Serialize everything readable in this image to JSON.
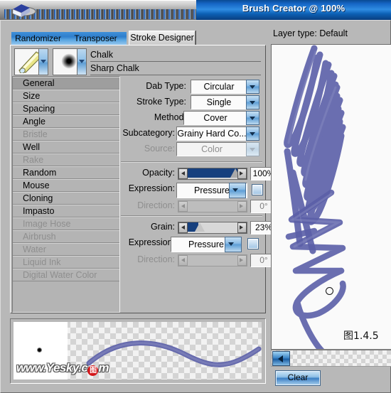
{
  "window": {
    "title": "Brush Creator @ 100%",
    "grip_icon": "paint-bucket-icon"
  },
  "tabs": [
    {
      "label": "Randomizer",
      "active": false
    },
    {
      "label": "Transposer",
      "active": false
    },
    {
      "label": "Stroke Designer",
      "active": true
    }
  ],
  "brush_header": {
    "category_thumb_icon": "chalk-stick-icon",
    "variant_thumb_icon": "soft-dab-icon",
    "category_name": "Chalk",
    "variant_name": "Sharp Chalk"
  },
  "categories": [
    {
      "label": "General",
      "selected": true,
      "enabled": true
    },
    {
      "label": "Size",
      "selected": false,
      "enabled": true
    },
    {
      "label": "Spacing",
      "selected": false,
      "enabled": true
    },
    {
      "label": "Angle",
      "selected": false,
      "enabled": true
    },
    {
      "label": "Bristle",
      "selected": false,
      "enabled": false
    },
    {
      "label": "Well",
      "selected": false,
      "enabled": true
    },
    {
      "label": "Rake",
      "selected": false,
      "enabled": false
    },
    {
      "label": "Random",
      "selected": false,
      "enabled": true
    },
    {
      "label": "Mouse",
      "selected": false,
      "enabled": true
    },
    {
      "label": "Cloning",
      "selected": false,
      "enabled": true
    },
    {
      "label": "Impasto",
      "selected": false,
      "enabled": true
    },
    {
      "label": "Image Hose",
      "selected": false,
      "enabled": false
    },
    {
      "label": "Airbrush",
      "selected": false,
      "enabled": false
    },
    {
      "label": "Water",
      "selected": false,
      "enabled": false
    },
    {
      "label": "Liquid Ink",
      "selected": false,
      "enabled": false
    },
    {
      "label": "Digital Water Color",
      "selected": false,
      "enabled": false
    }
  ],
  "general": {
    "dab_type": {
      "label": "Dab Type:",
      "value": "Circular"
    },
    "stroke_type": {
      "label": "Stroke Type:",
      "value": "Single"
    },
    "method": {
      "label": "Method:",
      "value": "Cover"
    },
    "subcategory": {
      "label": "Subcategory:",
      "value": "Grainy Hard Co..."
    },
    "source": {
      "label": "Source:",
      "value": "Color",
      "enabled": false
    },
    "opacity": {
      "label": "Opacity:",
      "value": "100%",
      "percent": 100
    },
    "opacity_expression": {
      "label": "Expression:",
      "value": "Pressure",
      "checkbox_checked": false
    },
    "opacity_direction": {
      "label": "Direction:",
      "value": "0°",
      "enabled": false
    },
    "grain": {
      "label": "Grain:",
      "value": "23%",
      "percent": 23
    },
    "grain_expression": {
      "label": "Expression:",
      "value": "Pressure",
      "checkbox_checked": false
    },
    "grain_direction": {
      "label": "Direction:",
      "value": "0°",
      "enabled": false
    }
  },
  "preview": {
    "layer_type_label": "Layer type: Default",
    "figure_caption": "图1.4.5",
    "scroll_left_icon": "arrow-left-icon",
    "clear_button": "Clear",
    "stroke_color": "#5b5fa8"
  },
  "stroke_preview": {
    "watermark_prefix": "www.Yesky.c",
    "watermark_badge": "图",
    "watermark_suffix": "m",
    "dab_icon": "brush-dab-icon"
  }
}
